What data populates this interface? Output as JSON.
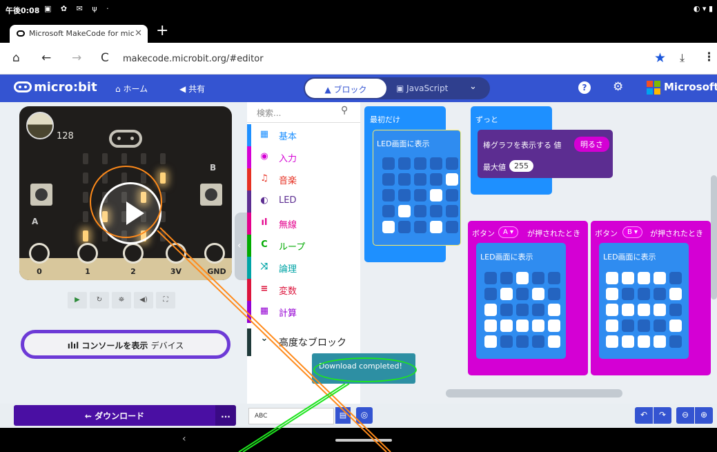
{
  "status": {
    "time": "午後0:08",
    "left_icons": "▣ ✿ ✉ ψ ·",
    "right_icons": "◐ ▾ ▮"
  },
  "browser": {
    "tab_title": "Microsoft MakeCode for mic",
    "tab_close": "✕",
    "new_tab": "+",
    "nav_home": "⌂",
    "nav_back": "←",
    "nav_forward": "→",
    "nav_reload": "C",
    "url": "makecode.microbit.org/#editor",
    "star": "★",
    "download": "⤓",
    "menu": "⋮"
  },
  "header": {
    "logo": "micro:bit",
    "home": "ホーム",
    "share": "共有",
    "blocks": "ブロック",
    "javascript": "JavaScript",
    "help": "?",
    "settings": "⚙",
    "microsoft": "Microsoft",
    "brand_colors": [
      "#f25022",
      "#7fba00",
      "#00a4ef",
      "#ffb900"
    ]
  },
  "simulator": {
    "light_level": "128",
    "button_a": "A",
    "button_b": "B",
    "pins": [
      "0",
      "1",
      "2",
      "3V",
      "GND"
    ],
    "controls": [
      "▶",
      "↻",
      "⛯",
      "◀)",
      "⛶"
    ],
    "console_label": "コンソールを表示",
    "console_device": "デバイス",
    "collapse": "‹"
  },
  "toolbox": {
    "search_placeholder": "検索...",
    "categories": [
      {
        "label": "基本",
        "icon": "grid-icon",
        "glyph": "▦",
        "color": "#1e90ff"
      },
      {
        "label": "入力",
        "icon": "target-icon",
        "glyph": "◉",
        "color": "#d400d4"
      },
      {
        "label": "音楽",
        "icon": "headphones-icon",
        "glyph": "♫",
        "color": "#e63022"
      },
      {
        "label": "LED",
        "icon": "toggle-icon",
        "glyph": "◐",
        "color": "#5c2d91"
      },
      {
        "label": "無線",
        "icon": "signal-icon",
        "glyph": "ıl",
        "color": "#e3008c"
      },
      {
        "label": "ループ",
        "icon": "loop-icon",
        "glyph": "C",
        "color": "#00aa00"
      },
      {
        "label": "論理",
        "icon": "shuffle-icon",
        "glyph": "⤨",
        "color": "#00a4a6"
      },
      {
        "label": "変数",
        "icon": "list-icon",
        "glyph": "≡",
        "color": "#dc143c"
      },
      {
        "label": "計算",
        "icon": "calculator-icon",
        "glyph": "▦",
        "color": "#9400d3"
      }
    ],
    "advanced": "高度なブロック"
  },
  "workspace": {
    "on_start": "最初だけ",
    "show_leds": "LED画面に表示",
    "forever": "ずっと",
    "plot_bar": "棒グラフを表示する 値",
    "light_sensor": "明るさ",
    "max_value_label": "最大値",
    "max_value": "255",
    "button_prefix": "ボタン",
    "button_a": "A",
    "button_b": "B",
    "pressed_suffix": "が押されたとき",
    "leds_on_start": [
      [
        0,
        0,
        0,
        0,
        0
      ],
      [
        0,
        0,
        0,
        0,
        1
      ],
      [
        0,
        0,
        0,
        1,
        0
      ],
      [
        0,
        1,
        0,
        0,
        0
      ],
      [
        1,
        0,
        0,
        1,
        0
      ]
    ],
    "leds_button_a": [
      [
        0,
        0,
        1,
        0,
        0
      ],
      [
        0,
        1,
        0,
        1,
        0
      ],
      [
        1,
        0,
        0,
        0,
        1
      ],
      [
        1,
        1,
        1,
        1,
        1
      ],
      [
        1,
        0,
        0,
        0,
        1
      ]
    ],
    "leds_button_b": [
      [
        1,
        1,
        1,
        1,
        0
      ],
      [
        1,
        0,
        0,
        0,
        1
      ],
      [
        1,
        1,
        1,
        1,
        0
      ],
      [
        1,
        0,
        0,
        0,
        1
      ],
      [
        1,
        1,
        1,
        1,
        0
      ]
    ]
  },
  "toast": {
    "message": "Download completed!"
  },
  "bottom": {
    "download": "ダウンロード",
    "more": "...",
    "project_name": "ABC",
    "save": "▤",
    "github": "◎",
    "undo": "↶",
    "redo": "↷",
    "zoom_out": "⊖",
    "zoom_in": "⊕"
  },
  "android": {
    "back": "‹"
  }
}
